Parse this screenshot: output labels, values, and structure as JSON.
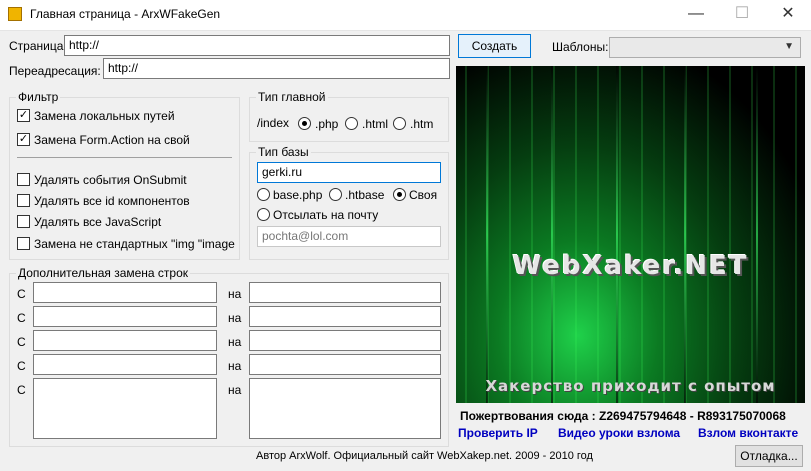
{
  "window": {
    "title": "Главная страница - ArxWFakeGen",
    "minimize_glyph": "—",
    "maximize_glyph": "☐",
    "close_glyph": "✕"
  },
  "page": {
    "label": "Страница:",
    "value": "http://"
  },
  "redirect": {
    "label": "Переадресация:",
    "value": "http://"
  },
  "create_button": "Создать",
  "templates": {
    "label": "Шаблоны:",
    "value": ""
  },
  "filter": {
    "title": "Фильтр",
    "checks": [
      {
        "label": "Замена локальных путей",
        "checked": true,
        "mark": "✓"
      },
      {
        "label": "Замена Form.Action на свой",
        "checked": true,
        "mark": "✓"
      },
      {
        "label": "Удалять события OnSubmit",
        "checked": false,
        "mark": ""
      },
      {
        "label": "Удалять все id компонентов",
        "checked": false,
        "mark": ""
      },
      {
        "label": "Удалять все JavaScript",
        "checked": false,
        "mark": ""
      },
      {
        "label": "Замена не стандартных \"img \"image",
        "checked": false,
        "mark": ""
      }
    ]
  },
  "main_type": {
    "title": "Тип главной",
    "prefix": "/index",
    "options": [
      ".php",
      ".html",
      ".htm"
    ],
    "selected": ".php"
  },
  "base_type": {
    "title": "Тип базы",
    "value": "gerki.ru",
    "options": [
      "base.php",
      ".htbase",
      "Своя"
    ],
    "selected": "Своя",
    "mail_option": "Отсылать на почту",
    "mail_value": "pochta@lol.com"
  },
  "replace": {
    "title": "Дополнительная замена строк",
    "from_label": "С",
    "to_label": "на",
    "rows": [
      {
        "from": "",
        "to": ""
      },
      {
        "from": "",
        "to": ""
      },
      {
        "from": "",
        "to": ""
      },
      {
        "from": "",
        "to": ""
      },
      {
        "from": "",
        "to": ""
      }
    ]
  },
  "banner": {
    "logo": "WebXaker.NET",
    "slogan": "Хакерство приходит с опытом"
  },
  "donate": "Пожертвования сюда : Z269475794648 - R893175070068",
  "links": {
    "check_ip": "Проверить IP",
    "video": "Видео уроки взлома",
    "vk": "Взлом вконтакте"
  },
  "footer": "Автор ArxWolf. Официальный сайт WebXakep.net. 2009 - 2010 год",
  "debug_button": "Отладка...",
  "colors": {
    "link": "#0000c0",
    "accent": "#0078d7",
    "matrix_green": "#1fd14a"
  }
}
